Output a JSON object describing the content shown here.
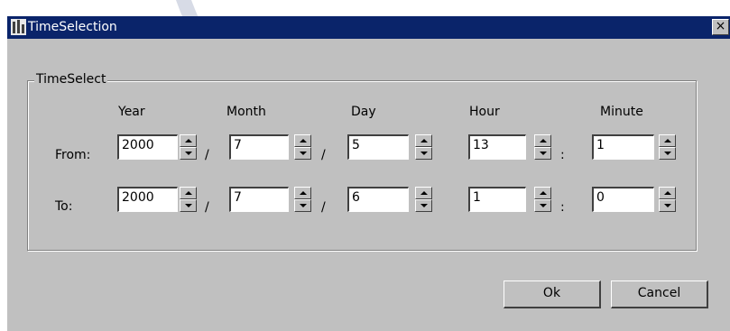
{
  "window": {
    "title": "TimeSelection",
    "close_glyph": "×"
  },
  "group": {
    "label": "TimeSelect"
  },
  "columns": {
    "year": "Year",
    "month": "Month",
    "day": "Day",
    "hour": "Hour",
    "minute": "Minute"
  },
  "rows": {
    "from": {
      "label": "From:",
      "year": "2000",
      "month": "7",
      "day": "5",
      "hour": "13",
      "minute": "1"
    },
    "to": {
      "label": "To:",
      "year": "2000",
      "month": "7",
      "day": "6",
      "hour": "1",
      "minute": "0"
    }
  },
  "separators": {
    "date": "/",
    "time": ":"
  },
  "buttons": {
    "ok": "Ok",
    "cancel": "Cancel"
  },
  "icons": {
    "app": "app-icon",
    "close": "close-icon",
    "spin_up": "spin-up-arrow-icon",
    "spin_down": "spin-down-arrow-icon"
  },
  "colors": {
    "titlebar": "#0a246a",
    "face": "#c0c0c0"
  }
}
